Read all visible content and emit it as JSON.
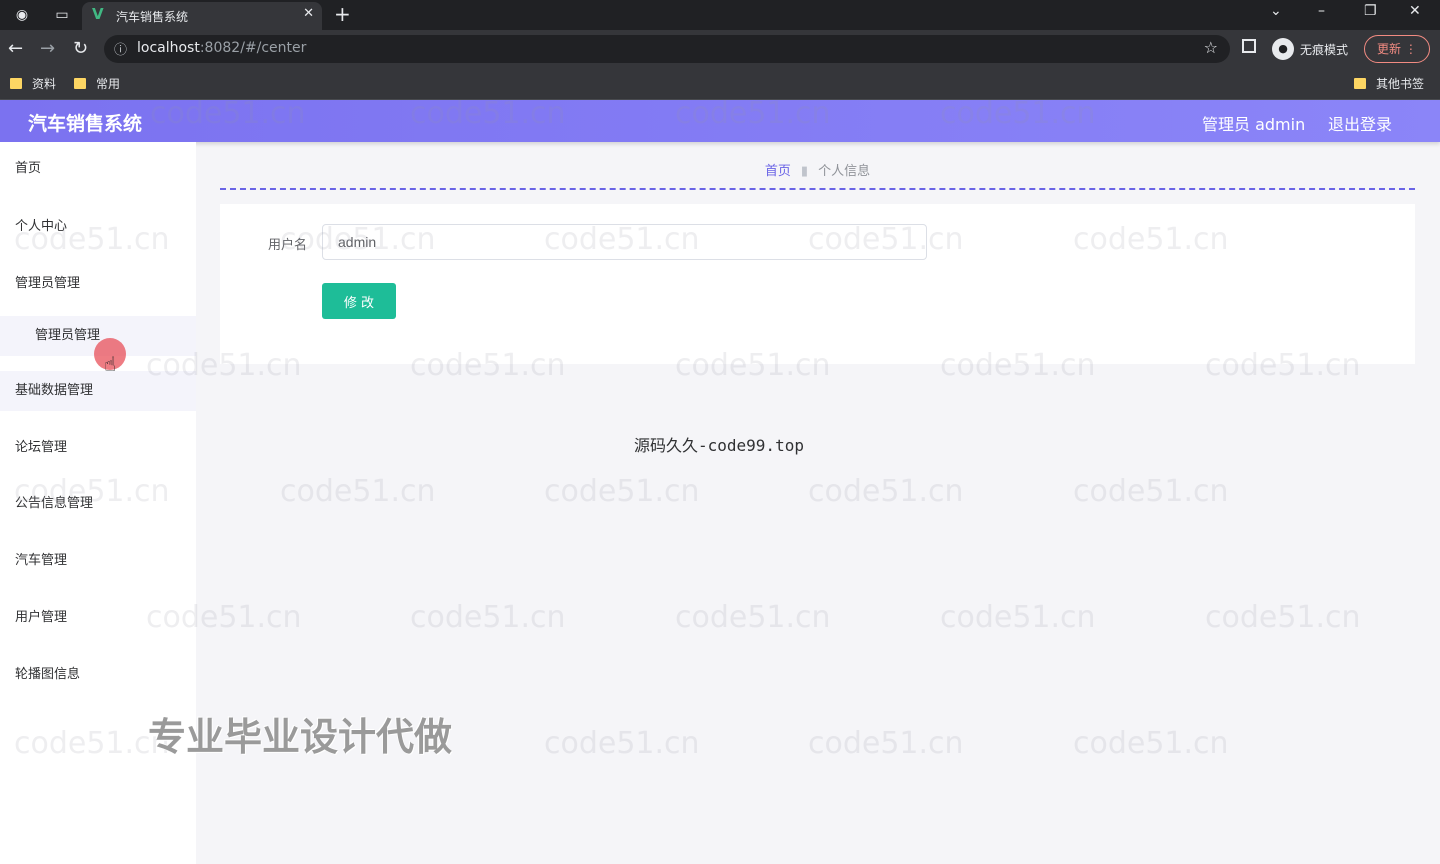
{
  "browser": {
    "tab_title": "汽车销售系统",
    "url_host": "localhost",
    "url_rest": ":8082/#/center",
    "incognito_label": "无痕模式",
    "update_label": "更新",
    "bookmarks": [
      "资料",
      "常用"
    ],
    "other_bookmarks": "其他书签"
  },
  "header": {
    "title": "汽车销售系统",
    "admin_label": "管理员 admin",
    "logout": "退出登录"
  },
  "sidebar": {
    "items": [
      {
        "label": "首页"
      },
      {
        "label": "个人中心"
      },
      {
        "label": "管理员管理"
      },
      {
        "label": "管理员管理"
      },
      {
        "label": "基础数据管理"
      },
      {
        "label": "论坛管理"
      },
      {
        "label": "公告信息管理"
      },
      {
        "label": "汽车管理"
      },
      {
        "label": "用户管理"
      },
      {
        "label": "轮播图信息"
      }
    ]
  },
  "breadcrumb": {
    "home": "首页",
    "current": "个人信息"
  },
  "form": {
    "username_label": "用户名",
    "username_value": "admin",
    "submit_label": "修 改"
  },
  "footer_note": "源码久久-code99.top",
  "overlay_text": "专业毕业设计代做",
  "watermark": "code51.cn"
}
